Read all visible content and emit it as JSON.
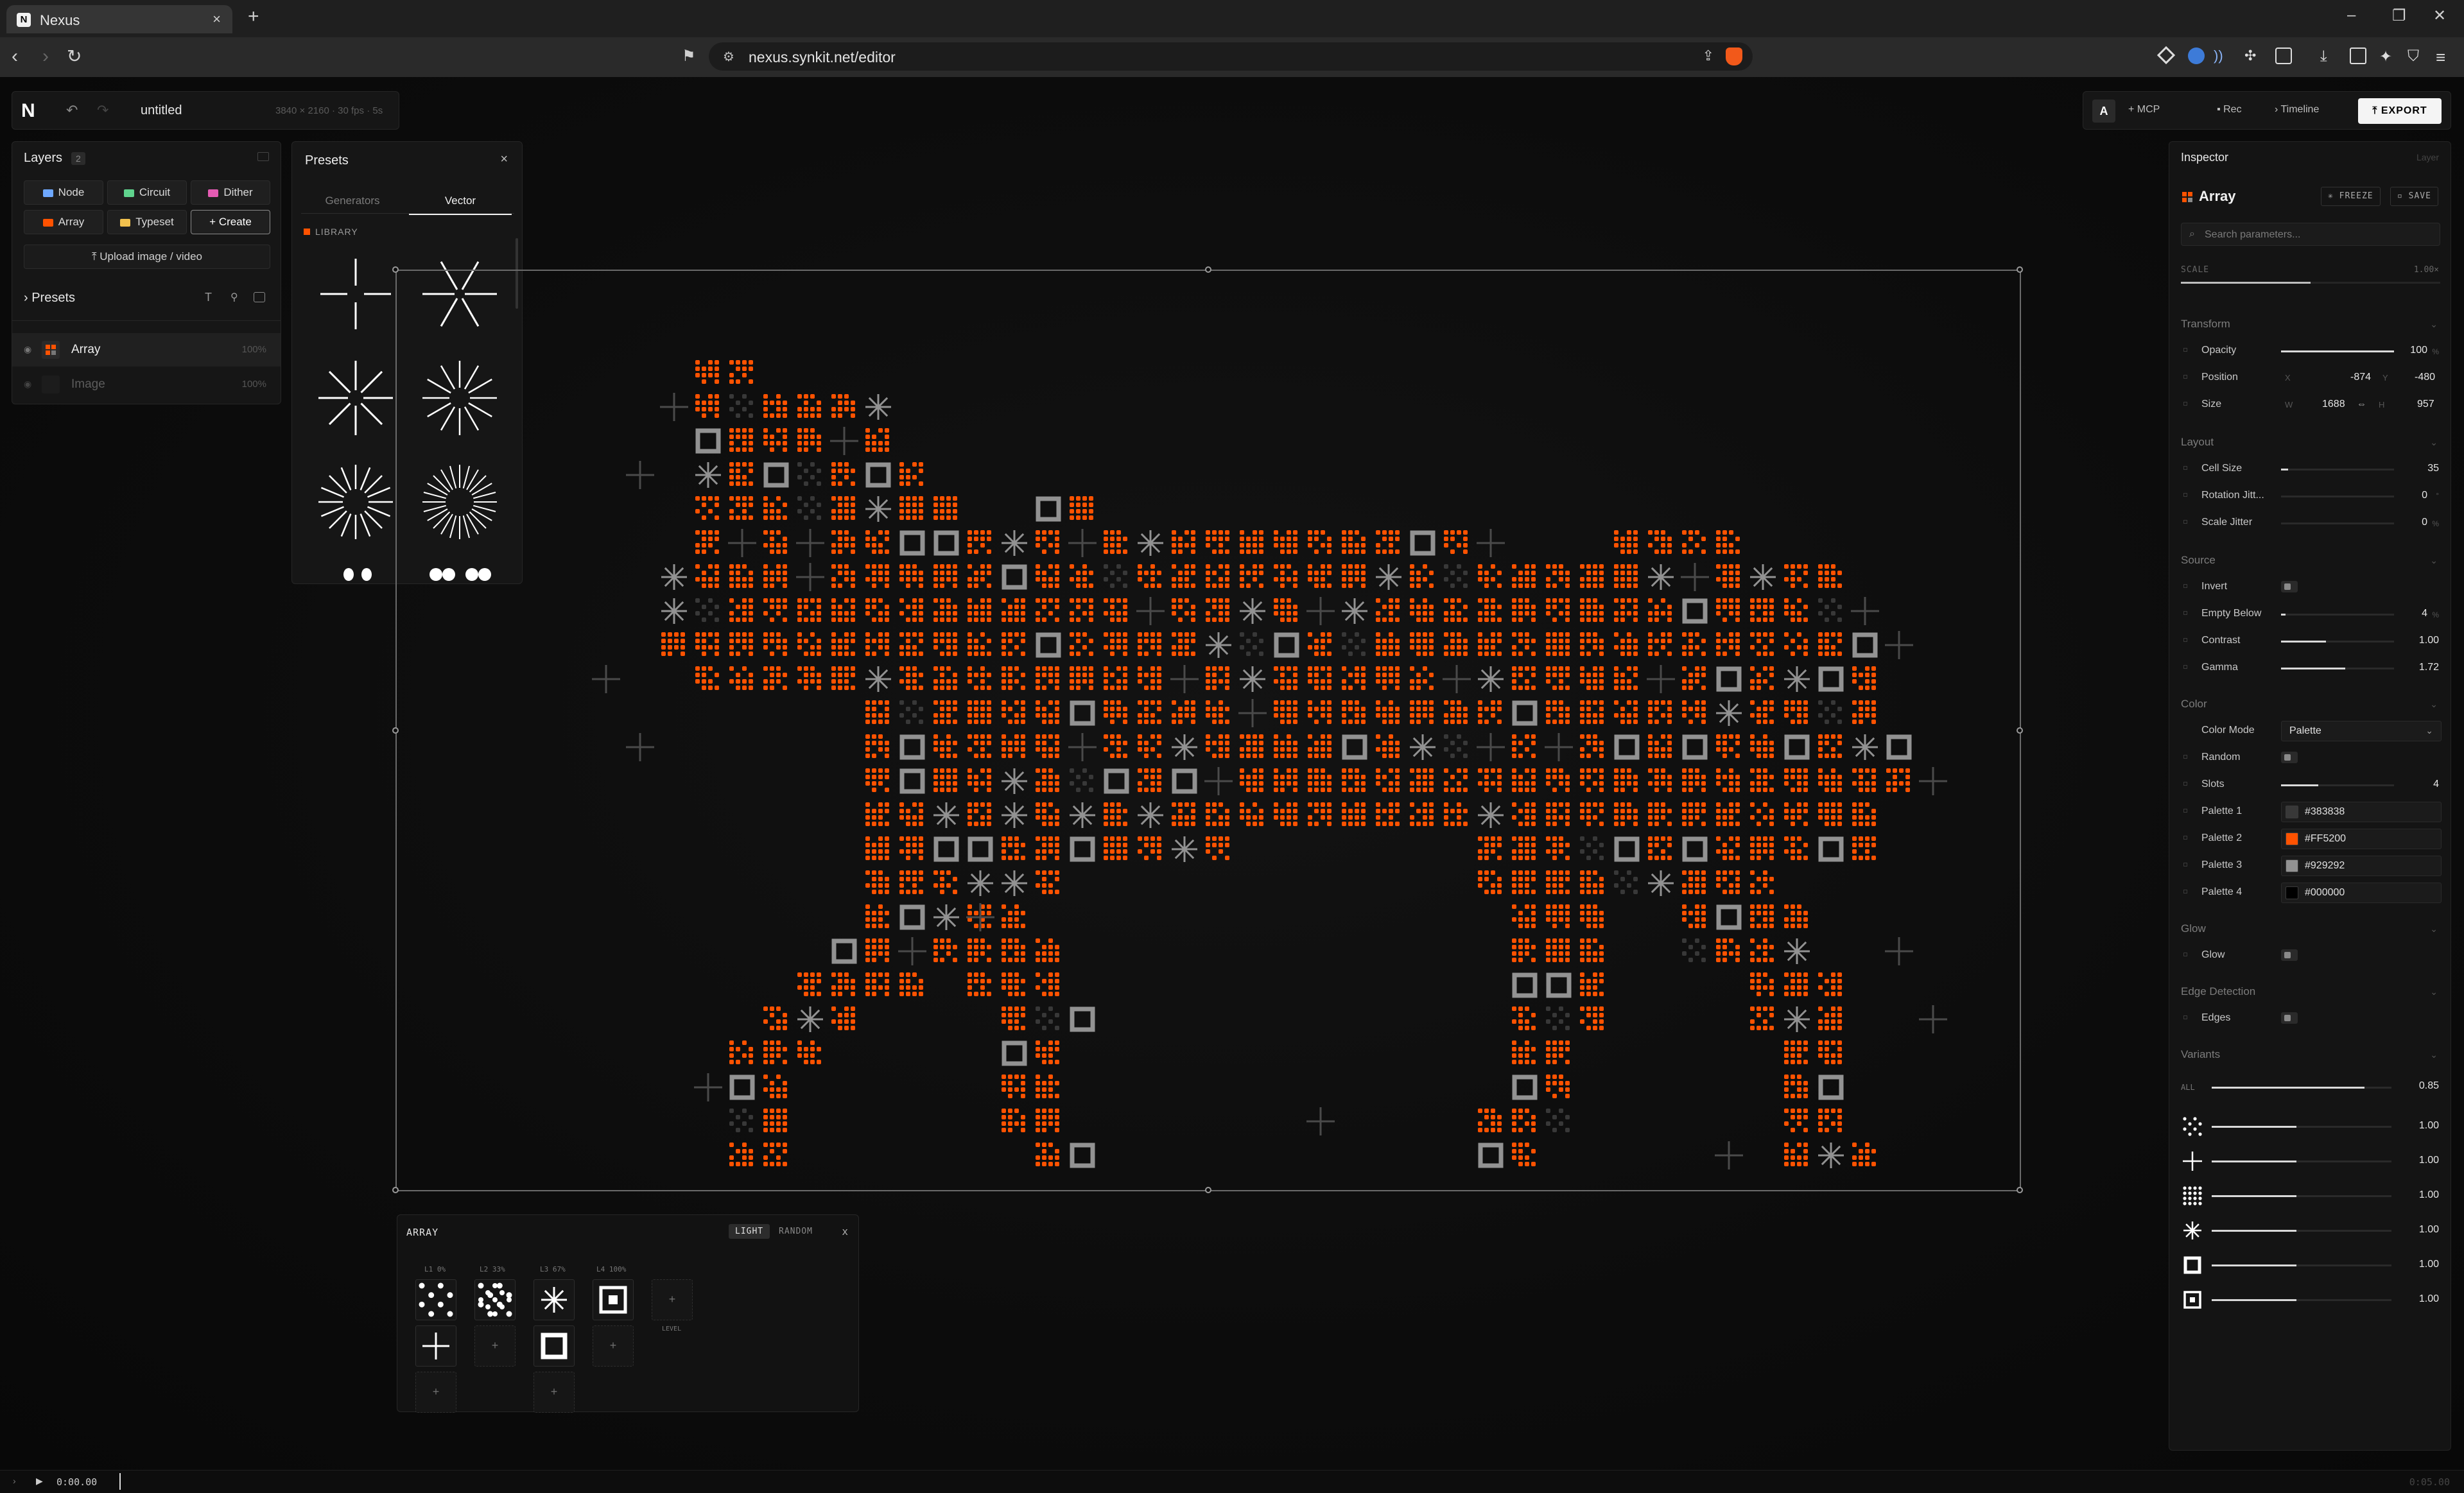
{
  "browser": {
    "tab_title": "Nexus",
    "tab_close": "×",
    "new_tab": "+",
    "url": "nexus.synkit.net/editor",
    "win_min": "–",
    "win_max": "❐",
    "win_close": "✕"
  },
  "toolbar": {
    "logo": "N",
    "undo": "↶",
    "redo": "↷",
    "doc_name": "untitled",
    "doc_meta": "3840 × 2160 · 30 fps · 5s",
    "a_label": "A",
    "mcp_label": "MCP",
    "rec_label": "Rec",
    "timeline_label": "Timeline",
    "export_label": "EXPORT"
  },
  "layers": {
    "title": "Layers",
    "count": "2",
    "buttons": [
      "Node",
      "Circuit",
      "Dither",
      "Array",
      "Typeset",
      "Create"
    ],
    "upload_label": "Upload image / video",
    "presets_label": "Presets",
    "items": [
      {
        "name": "Array",
        "opacity": "100%"
      },
      {
        "name": "Image",
        "opacity": "100%"
      }
    ]
  },
  "presets": {
    "title": "Presets",
    "tabs": [
      "Generators",
      "Vector"
    ],
    "library_label": "LIBRARY"
  },
  "array_editor": {
    "title": "ARRAY",
    "light_label": "LIGHT",
    "random_label": "RANDOM",
    "close": "x",
    "levels": [
      "L1 0%",
      "L2 33%",
      "L3 67%",
      "L4 100%"
    ],
    "add_level_label": "LEVEL",
    "plus": "+"
  },
  "inspector": {
    "title": "Inspector",
    "subtitle": "Layer",
    "layer_name": "Array",
    "freeze_label": "FREEZE",
    "save_label": "SAVE",
    "search_placeholder": "Search parameters...",
    "scale_label": "SCALE",
    "scale_value": "1.00×",
    "sections": {
      "transform": "Transform",
      "layout": "Layout",
      "source": "Source",
      "color": "Color",
      "glow": "Glow",
      "edge": "Edge Detection",
      "variants": "Variants"
    },
    "opacity": {
      "label": "Opacity",
      "value": "100",
      "unit": "%",
      "level": 1.0
    },
    "position": {
      "label": "Position",
      "x_label": "X",
      "x": "-874",
      "y_label": "Y",
      "y": "-480"
    },
    "size": {
      "label": "Size",
      "w_label": "W",
      "w": "1688",
      "link": "⇔",
      "h_label": "H",
      "h": "957"
    },
    "cell_size": {
      "label": "Cell Size",
      "value": "35",
      "level": 0.06
    },
    "rotation_jitter": {
      "label": "Rotation Jitt...",
      "value": "0",
      "unit": "°",
      "level": 0.0
    },
    "scale_jitter": {
      "label": "Scale Jitter",
      "value": "0",
      "unit": "%",
      "level": 0.0
    },
    "invert": {
      "label": "Invert"
    },
    "empty_below": {
      "label": "Empty Below",
      "value": "4",
      "unit": "%",
      "level": 0.04
    },
    "contrast": {
      "label": "Contrast",
      "value": "1.00",
      "level": 0.4
    },
    "gamma": {
      "label": "Gamma",
      "value": "1.72",
      "level": 0.57
    },
    "color_mode": {
      "label": "Color Mode",
      "value": "Palette"
    },
    "random": {
      "label": "Random"
    },
    "slots": {
      "label": "Slots",
      "value": "4",
      "level": 0.33
    },
    "palette": [
      {
        "label": "Palette 1",
        "hex": "#383838"
      },
      {
        "label": "Palette 2",
        "hex": "#FF5200"
      },
      {
        "label": "Palette 3",
        "hex": "#929292"
      },
      {
        "label": "Palette 4",
        "hex": "#000000"
      }
    ],
    "glow": {
      "label": "Glow"
    },
    "edges": {
      "label": "Edges"
    },
    "variants_all": {
      "label": "ALL",
      "value": "0.85",
      "level": 0.85
    },
    "variant_values": [
      "1.00",
      "1.00",
      "1.00",
      "1.00",
      "1.00",
      "1.00"
    ]
  },
  "timeline": {
    "time": "0:00.00",
    "end_time": "0:05.00"
  },
  "colors": {
    "accent": "#ff5200",
    "grey_light": "#929292",
    "grey_dark": "#383838"
  }
}
